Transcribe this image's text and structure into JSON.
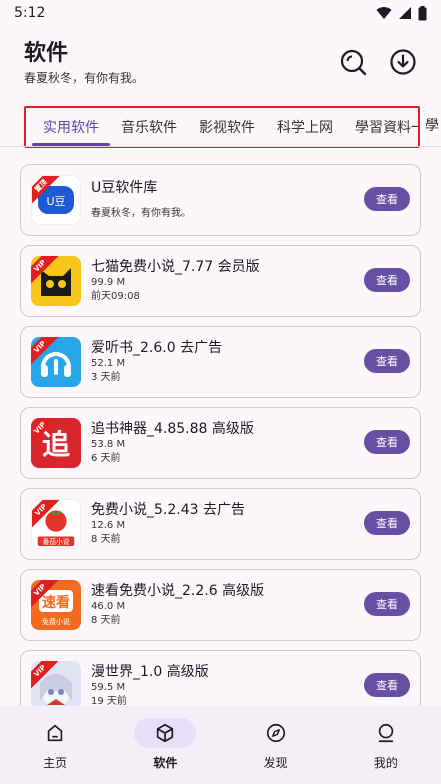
{
  "status": {
    "time": "5:12"
  },
  "header": {
    "title": "软件",
    "subtitle": "春夏秋冬，有你有我。"
  },
  "tabs": [
    {
      "label": "实用软件",
      "active": true
    },
    {
      "label": "音乐软件"
    },
    {
      "label": "影视软件"
    },
    {
      "label": "科学上网"
    },
    {
      "label": "學習資料一"
    }
  ],
  "apps": [
    {
      "name": "U豆软件库",
      "size": "",
      "time": "春夏秋冬，有你有我。",
      "ribbon": "置顶",
      "icon_bg": "#ffffff",
      "icon_inner": "#1e5ad6",
      "icon_text": "U豆"
    },
    {
      "name": "七猫免费小说_7.77 会员版",
      "size": "99.9 M",
      "time": "前天09:08",
      "ribbon": "VIP",
      "icon_bg": "#f8c51c",
      "icon_inner": "#1a1a1a",
      "icon_text": ""
    },
    {
      "name": "爱听书_2.6.0 去广告",
      "size": "52.1 M",
      "time": "3 天前",
      "ribbon": "VIP",
      "icon_bg": "#27a7e8",
      "icon_inner": "#ffffff",
      "icon_text": ""
    },
    {
      "name": "追书神器_4.85.88 高级版",
      "size": "53.8 M",
      "time": "6 天前",
      "ribbon": "VIP",
      "icon_bg": "#d8262d",
      "icon_inner": "#ffffff",
      "icon_text": "追"
    },
    {
      "name": "免费小说_5.2.43 去广告",
      "size": "12.6 M",
      "time": "8 天前",
      "ribbon": "VIP",
      "icon_bg": "#ffffff",
      "icon_inner": "#e5332a",
      "icon_text": "番茄小说"
    },
    {
      "name": "速看免费小说_2.2.6 高级版",
      "size": "46.0 M",
      "time": "8 天前",
      "ribbon": "VIP",
      "icon_bg": "#f36b21",
      "icon_inner": "#ffffff",
      "icon_text": "免费小说"
    },
    {
      "name": "漫世界_1.0 高级版",
      "size": "59.5 M",
      "time": "19 天前",
      "ribbon": "VIP",
      "icon_bg": "#dfe3f3",
      "icon_inner": "#7b86b8",
      "icon_text": ""
    }
  ],
  "view_label": "查看",
  "nav": [
    {
      "label": "主页",
      "icon": "home-icon"
    },
    {
      "label": "软件",
      "icon": "cube-icon",
      "active": true
    },
    {
      "label": "发现",
      "icon": "compass-icon"
    },
    {
      "label": "我的",
      "icon": "person-icon"
    }
  ],
  "colors": {
    "accent": "#6750a4",
    "highlight_border": "#d92128",
    "background": "#fdf7fc"
  }
}
